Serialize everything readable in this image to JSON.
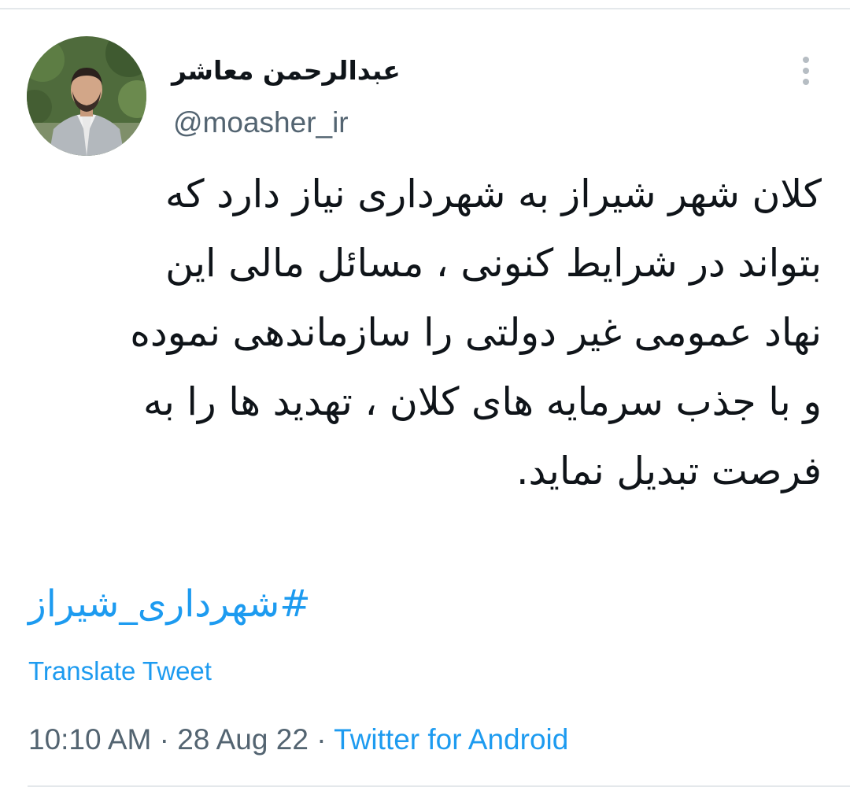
{
  "tweet": {
    "author": {
      "display_name": "عبدالرحمن معاشر",
      "handle": "@moasher_ir"
    },
    "text_lines": [
      "کلان شهر شیراز به شهرداری نیاز دارد که",
      "بتواند در شرایط کنونی ، مسائل مالی این",
      "نهاد عمومی غیر دولتی را سازماندهی نموده",
      "و با جذب سرمایه های کلان ، تهدید ها را به",
      "فرصت تبدیل نماید."
    ],
    "hashtag": "#شهرداری_شیراز",
    "translate_label": "Translate Tweet",
    "time": "10:10 AM",
    "separator": "·",
    "date": "28 Aug 22",
    "source": "Twitter for Android"
  },
  "icons": {
    "more": "more-vertical-icon"
  },
  "colors": {
    "link": "#1d9bf0",
    "text": "#0f1419",
    "secondary": "#536471",
    "divider": "#e4e8eb"
  }
}
